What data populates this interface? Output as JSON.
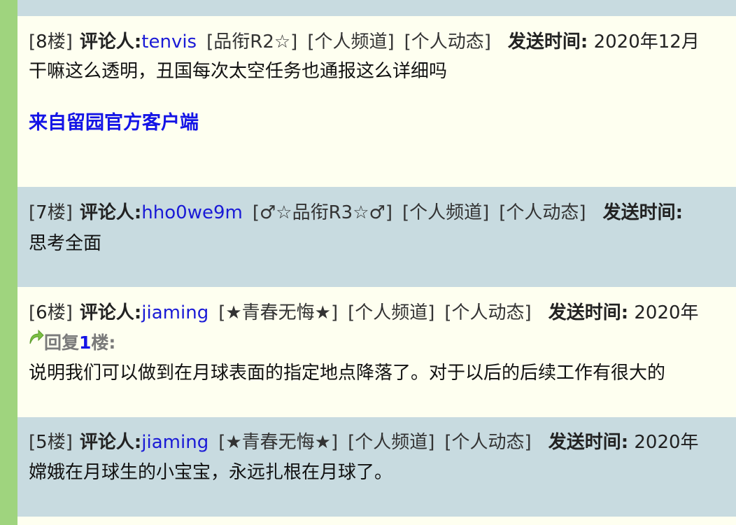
{
  "labels": {
    "floor_suffix": "楼",
    "commenter": "评论人:",
    "send_time": "发送时间:",
    "channel": "[个人频道]",
    "activity": "[个人动态]"
  },
  "posts": [
    {
      "floor": "8",
      "user": "tenvis",
      "rank": "[品衔R2☆]",
      "time": "2020年12月",
      "body": "干嘛这么透明，丑国每次太空任务也通报这么详细吗",
      "client_link": "来自留园官方客户端"
    },
    {
      "floor": "7",
      "user": "hho0we9m",
      "rank": "[♂☆品衔R3☆♂]",
      "time": "",
      "body": "思考全面"
    },
    {
      "floor": "6",
      "user": "jiaming",
      "rank": "[★青春无悔★]",
      "time": "2020年",
      "reply_prefix": "回复",
      "reply_floor": "1",
      "reply_suffix": "楼:",
      "body": "说明我们可以做到在月球表面的指定地点降落了。对于以后的后续工作有很大的"
    },
    {
      "floor": "5",
      "user": "jiaming",
      "rank": "[★青春无悔★]",
      "time": "2020年",
      "body": "嫦娥在月球生的小宝宝，永远扎根在月球了。"
    }
  ],
  "colors": {
    "sidebar": "#9fd47e",
    "light_bg": "#fefff0",
    "blue_bg": "#c8dbe0",
    "username": "#1a1ad6",
    "client_link": "#1414e6",
    "reply_arrow": "#7bc043"
  },
  "icons": {
    "reply": "reply-arrow-icon"
  }
}
